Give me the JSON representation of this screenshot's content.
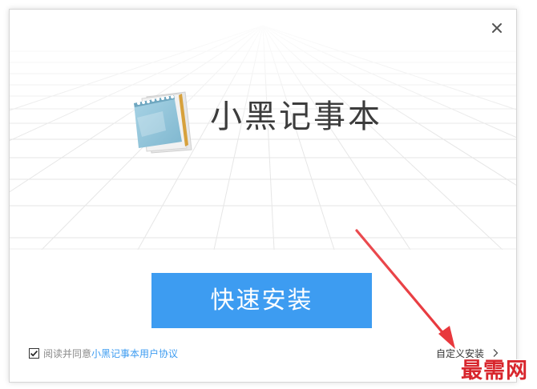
{
  "window": {
    "app_title": "小黑记事本",
    "close_icon": "close-icon",
    "install_button_label": "快速安装",
    "agreement": {
      "checked": true,
      "prefix_text": "阅读并同意 ",
      "link_text": "小黑记事本用户协议"
    },
    "custom_install_label": "自定义安装"
  },
  "watermark": {
    "text": "最需网"
  },
  "colors": {
    "accent": "#3d9cf1",
    "title_text": "#3c3c3c",
    "arrow": "#e8383d",
    "watermark": "#d8262d"
  },
  "icons": {
    "logo": "notepad-icon",
    "checkbox": "checkbox-checked-icon",
    "chevron": "chevron-right-icon",
    "annotation": "red-arrow"
  }
}
